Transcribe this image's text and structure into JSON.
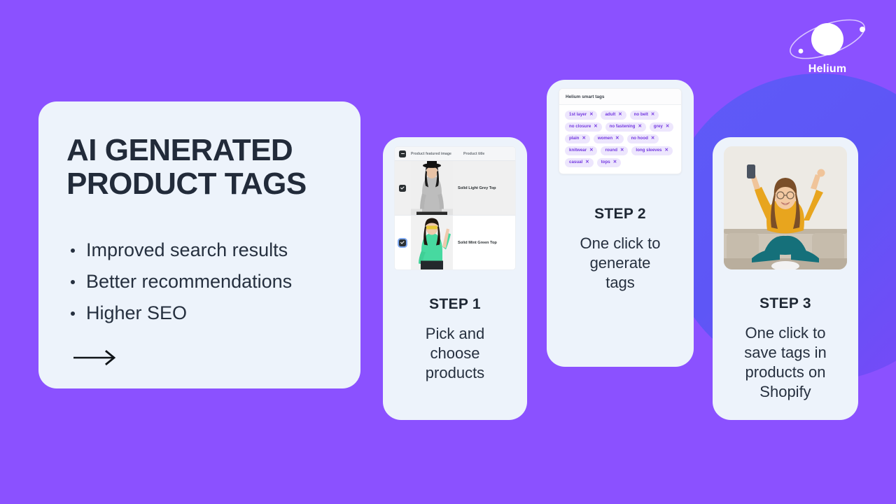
{
  "brand": {
    "name": "Helium",
    "logo_icon": "planet-orbit-icon",
    "accent": "#8B51FF"
  },
  "theme": {
    "background": "#8B51FF",
    "blob": "#5C58F7",
    "card_bg": "#EDF3FB",
    "heading": "#222B3A",
    "tag_bg": "#EDE6FD",
    "tag_text": "#7338E0"
  },
  "info_card": {
    "title": "AI GENERATED\nPRODUCT TAGS",
    "bullets": [
      "Improved search results",
      "Better recommendations",
      "Higher SEO"
    ],
    "arrow_icon": "arrow-right-icon"
  },
  "steps": [
    {
      "label": "STEP 1",
      "description": "Pick and\nchoose\nproducts",
      "mock": {
        "type": "product-table",
        "columns": [
          "Product featured image",
          "Product title"
        ],
        "rows": [
          {
            "title": "Solid Light Grey Top",
            "checked": true,
            "focused": false
          },
          {
            "title": "Solid Mint Green Top",
            "checked": true,
            "focused": true
          }
        ],
        "header_checkbox": "indeterminate"
      }
    },
    {
      "label": "STEP 2",
      "description": "One click to\ngenerate\ntags",
      "mock": {
        "type": "tags-panel",
        "panel_title": "Helium smart tags",
        "tags": [
          "1st layer",
          "adult",
          "no belt",
          "no closure",
          "no fastening",
          "grey",
          "plain",
          "women",
          "no hood",
          "knitwear",
          "round",
          "long sleeves",
          "casual",
          "tops"
        ],
        "remove_icon": "close-x-icon"
      }
    },
    {
      "label": "STEP 3",
      "description": "One click to\nsave tags in\nproducts on\nShopify",
      "mock": {
        "type": "photo",
        "alt": "Woman in yellow sweater celebrating with arms raised on a couch holding a phone"
      }
    }
  ]
}
